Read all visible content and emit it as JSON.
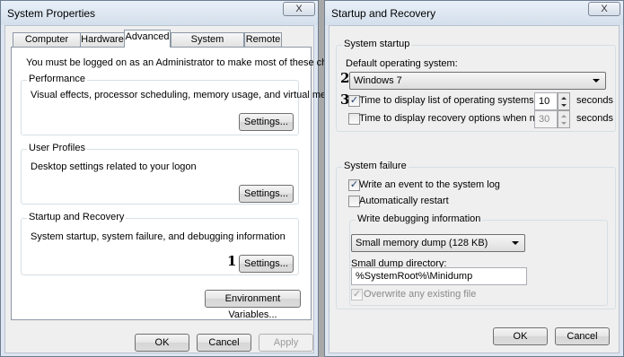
{
  "system_properties": {
    "title": "System Properties",
    "close_label": "X",
    "tabs": [
      {
        "label": "Computer Name"
      },
      {
        "label": "Hardware"
      },
      {
        "label": "Advanced"
      },
      {
        "label": "System Protection"
      },
      {
        "label": "Remote"
      }
    ],
    "admin_notice": "You must be logged on as an Administrator to make most of these changes.",
    "performance": {
      "legend": "Performance",
      "description": "Visual effects, processor scheduling, memory usage, and virtual memory",
      "settings_label": "Settings..."
    },
    "user_profiles": {
      "legend": "User Profiles",
      "description": "Desktop settings related to your logon",
      "settings_label": "Settings..."
    },
    "startup_recovery": {
      "legend": "Startup and Recovery",
      "description": "System startup, system failure, and debugging information",
      "settings_label": "Settings...",
      "marker": "1"
    },
    "env_vars_label": "Environment Variables...",
    "ok_label": "OK",
    "cancel_label": "Cancel",
    "apply_label": "Apply"
  },
  "startup_and_recovery": {
    "title": "Startup and Recovery",
    "close_label": "X",
    "system_startup": {
      "legend": "System startup",
      "default_os_label": "Default operating system:",
      "default_os_value": "Windows 7",
      "marker_os": "2",
      "marker_time": "3",
      "time_list_label": "Time to display list of operating systems:",
      "time_list_checked": true,
      "time_list_value": "10",
      "time_recovery_label": "Time to display recovery options when needed:",
      "time_recovery_checked": false,
      "time_recovery_value": "30",
      "seconds_label": "seconds"
    },
    "system_failure": {
      "legend": "System failure",
      "write_event_label": "Write an event to the system log",
      "write_event_checked": true,
      "auto_restart_label": "Automatically restart",
      "auto_restart_checked": false,
      "debug_info": {
        "legend": "Write debugging information",
        "dump_type": "Small memory dump (128 KB)",
        "dump_dir_label": "Small dump directory:",
        "dump_dir_value": "%SystemRoot%\\Minidump",
        "overwrite_label": "Overwrite any existing file",
        "overwrite_checked": true
      }
    },
    "ok_label": "OK",
    "cancel_label": "Cancel"
  }
}
